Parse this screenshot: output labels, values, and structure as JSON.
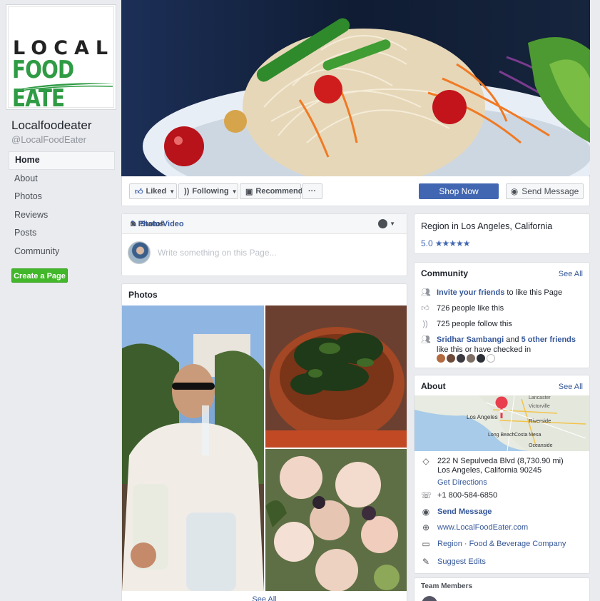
{
  "page": {
    "logo_line1": "LOCAL",
    "logo_line2": "FOOD EATE",
    "name": "Localfoodeater",
    "handle": "@LocalFoodEater"
  },
  "nav": {
    "items": [
      "Home",
      "About",
      "Photos",
      "Reviews",
      "Posts",
      "Community"
    ],
    "active": "Home",
    "create_page": "Create a Page"
  },
  "actions": {
    "liked": "Liked",
    "following": "Following",
    "recommend": "Recommend",
    "more": "···",
    "shop_now": "Shop Now",
    "send_message": "Send Message"
  },
  "composer": {
    "tab_status": "Status",
    "tab_photo": "Photo/Video",
    "placeholder": "Write something on this Page..."
  },
  "photos": {
    "title": "Photos",
    "see_all": "See All"
  },
  "region": {
    "title": "Region in Los Angeles, California",
    "rating": "5.0",
    "stars": "★★★★★"
  },
  "community": {
    "title": "Community",
    "see_all": "See All",
    "invite_link": "Invite your friends",
    "invite_rest": " to like this Page",
    "likes": "726 people like this",
    "follows": "725 people follow this",
    "friend_name": "Sridhar Sambangi",
    "and": " and ",
    "other_friends": "5 other friends",
    "friends_rest": " like this or have checked in"
  },
  "about": {
    "title": "About",
    "see_all": "See All",
    "map_labels": [
      "Lancaster",
      "Victorville",
      "Los Angeles",
      "Riverside",
      "Long Beach",
      "Costa Mesa",
      "Oceanside"
    ],
    "address_line1": "222 N Sepulveda Blvd (8,730.90 mi)",
    "address_line2": "Los Angeles, California 90245",
    "directions": "Get Directions",
    "phone": "+1 800-584-6850",
    "send_message": "Send Message",
    "website": "www.LocalFoodEater.com",
    "category": "Region · Food & Beverage Company",
    "suggest": "Suggest Edits"
  },
  "team": {
    "title": "Team Members"
  },
  "colors": {
    "brand_blue": "#4267b2",
    "link": "#365899",
    "green": "#42b72a",
    "logo_green": "#2f9b44"
  }
}
